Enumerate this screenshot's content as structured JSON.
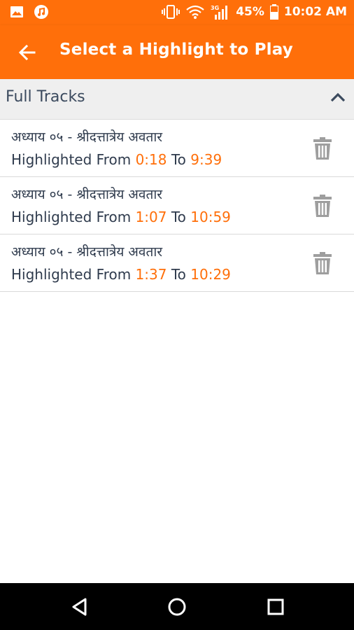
{
  "status_bar": {
    "battery_percent": "45%",
    "time": "10:02 AM",
    "icons": [
      "image-icon",
      "music-icon",
      "vibrate-icon",
      "wifi-icon",
      "signal-3g-icon",
      "battery-icon"
    ]
  },
  "app_bar": {
    "title": "Select a Highlight to Play",
    "back_icon": "arrow-back-icon"
  },
  "section": {
    "label": "Full Tracks",
    "expanded": true
  },
  "highlights": [
    {
      "name": "अध्याय ०५ - श्रीदत्तात्रेय अवतार",
      "prefix": "Highlighted From ",
      "from": "0:18",
      "mid": " To ",
      "to": "9:39"
    },
    {
      "name": "अध्याय ०५ - श्रीदत्तात्रेय अवतार",
      "prefix": "Highlighted From ",
      "from": "1:07",
      "mid": " To ",
      "to": "10:59"
    },
    {
      "name": "अध्याय ०५ - श्रीदत्तात्रेय अवतार",
      "prefix": "Highlighted From ",
      "from": "1:37",
      "mid": " To ",
      "to": "10:29"
    }
  ],
  "colors": {
    "accent": "#ff6f0a",
    "text": "#2f3b4d",
    "header_bg": "#efefef",
    "icon_gray": "#9e9e9e"
  },
  "nav": {
    "icons": [
      "back-triangle-icon",
      "home-circle-icon",
      "recents-square-icon"
    ]
  }
}
